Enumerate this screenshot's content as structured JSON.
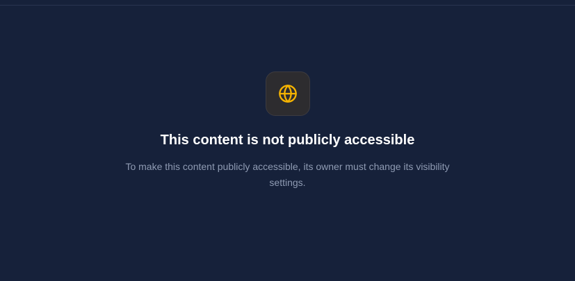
{
  "notice": {
    "icon": "globe-icon",
    "icon_color": "#f5b301",
    "title": "This content is not publicly accessible",
    "message": "To make this content publicly accessible, its owner must change its visibility settings."
  },
  "colors": {
    "background": "#16213a",
    "tile": "#2d2c2f",
    "title": "#ffffff",
    "message": "#8f9bb3"
  }
}
